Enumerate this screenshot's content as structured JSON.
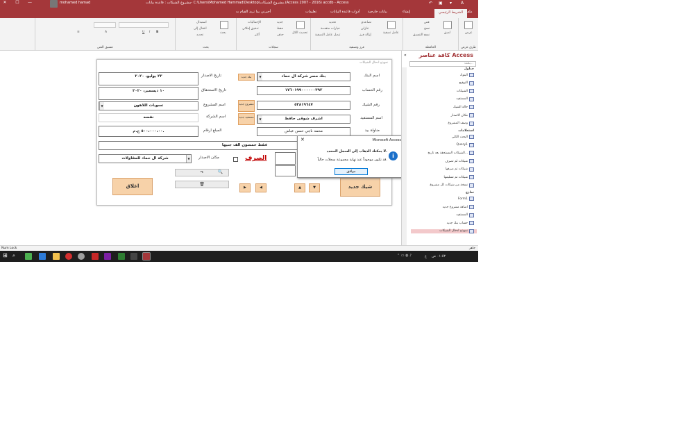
{
  "window": {
    "title": "مشروع الشيكات : قاعدة بيانات- C:\\Users\\Mohamed Hammad\\Desktop\\مشروع الشيكات.(Access 2007 - 2016) accdb - Access",
    "user": "mohamed hamad",
    "minimize": "—",
    "maximize": "☐",
    "close": "✕"
  },
  "tabs": [
    {
      "label": "ملف"
    },
    {
      "label": "الشريط الرئيسي"
    },
    {
      "label": "إنشاء"
    },
    {
      "label": "بيانات خارجية"
    },
    {
      "label": "أدوات قاعدة البيانات"
    },
    {
      "label": "تعليمات"
    },
    {
      "label": "أخبرني بما تريد القيام به"
    }
  ],
  "ribbon": {
    "groups": [
      {
        "label": "طرق عرض"
      },
      {
        "label": "الحافظة"
      },
      {
        "label": "فرز وتصفية"
      },
      {
        "label": "سجلات"
      },
      {
        "label": "بحث"
      },
      {
        "label": "تنسيق النص"
      }
    ],
    "items": {
      "view": "عرض",
      "paste": "لصق",
      "cut": "قص",
      "copy": "نسخ",
      "format_painter": "نسخ التنسيق",
      "filter": "عامل تصفية",
      "ascending": "تصاعدي",
      "descending": "تنازلي",
      "remove_sort": "إزالة فرز",
      "selection": "تحديد",
      "advanced": "خيارات متقدمة",
      "toggle_filter": "تبديل عامل التصفية",
      "new": "جديد",
      "save": "حفظ",
      "delete": "حذف",
      "totals": "الإجماليات",
      "spelling": "تدقيق إملائي",
      "more": "أكثر",
      "refresh_all": "تحديث الكل",
      "find": "بحث",
      "replace": "استبدال",
      "goto": "انتقال إلى",
      "select": "تحديد"
    }
  },
  "nav": {
    "title": "كافة عناصر Access",
    "search_placeholder": "بحث...",
    "sections": [
      {
        "title": "جداول",
        "items": [
          "البنوك",
          "التوقيع",
          "الشيكات",
          "المستفيد",
          "حالة الشيك",
          "مكان الاصدار",
          "وصف المشروع"
        ]
      },
      {
        "title": "استعلامات",
        "items": [
          "البحث الكلي",
          "Query1",
          "الشيكات المستحقة بعد تاريخ...",
          "شيكات لم تصرف",
          "شيكات تم صرفها",
          "شيكات تم تسليمها",
          "نسخة من شيكات كل مشروع"
        ]
      },
      {
        "title": "نماذج",
        "items": [
          "Form1",
          "اضافة مشروع جديد",
          "المستفيد",
          "حساب بنك جديد",
          "نموذج ادخال الشيكات"
        ]
      }
    ]
  },
  "form": {
    "caption": "نموذج ادخال الشيكات",
    "labels": {
      "bank": "اسم البنك",
      "account": "رقم الحساب",
      "cheque_no": "رقم الشيك",
      "beneficiary": "اسم المستفيد",
      "handler": "مناولة بيد",
      "issue_date": "تاريخ الاصدار",
      "due_date": "تاريخ الاستحقاق",
      "project": "اسم المشروع",
      "company": "اسم الشركة",
      "amount_num": "المبلغ ارقام",
      "issue_place": "مكان الاصدار"
    },
    "values": {
      "bank": "بنك مصر شركة ال حماد",
      "account": "١٧٦٠١٩٩٠٠٠٠٠٠٣٩٢",
      "cheque_no": "٥٣٨١٩٦٤٧",
      "beneficiary": "اشرف شوقى حافظ",
      "handler": "محمد ناجي حسن عباس",
      "issue_date": "٢٣ يوليو، ٢٠٢٠",
      "due_date": "١٠ ديسمبر، ٢٠٢٠",
      "project": "تسويات اللاهون",
      "company": "نفسه",
      "amount_num": "٥٠٠،٠٠٠،٠٠ ج.م.",
      "amount_words": "فقط خمسون الف جنيها",
      "issue_place": "شركة ال حماد للمقاولات",
      "status": "الصرف"
    },
    "buttons": {
      "new_bank": "بنك جديد",
      "new_project": "مشروع جديد",
      "new_beneficiary": "مستفيد جديد",
      "new_cheque": "شيك جديد",
      "close": "اغلاق",
      "redo": "↷",
      "search": "🔍",
      "delete": "🗑",
      "first": "▶",
      "prev": "◀",
      "up": "▲",
      "down": "▼"
    }
  },
  "dialog": {
    "title": "Microsoft Access",
    "close": "✕",
    "message1": "لا يمكنك الذهاب إلى السجل المحدد.",
    "message2": "قد تكون موجوداً عند نهاية مجموعة سجلات حالياً.",
    "ok": "موافق",
    "icon": "i"
  },
  "status": {
    "left": "Num Lock",
    "right": "جاهز"
  },
  "taskbar": {
    "time": "٠١:٥٣ ص",
    "lang": "ع"
  }
}
